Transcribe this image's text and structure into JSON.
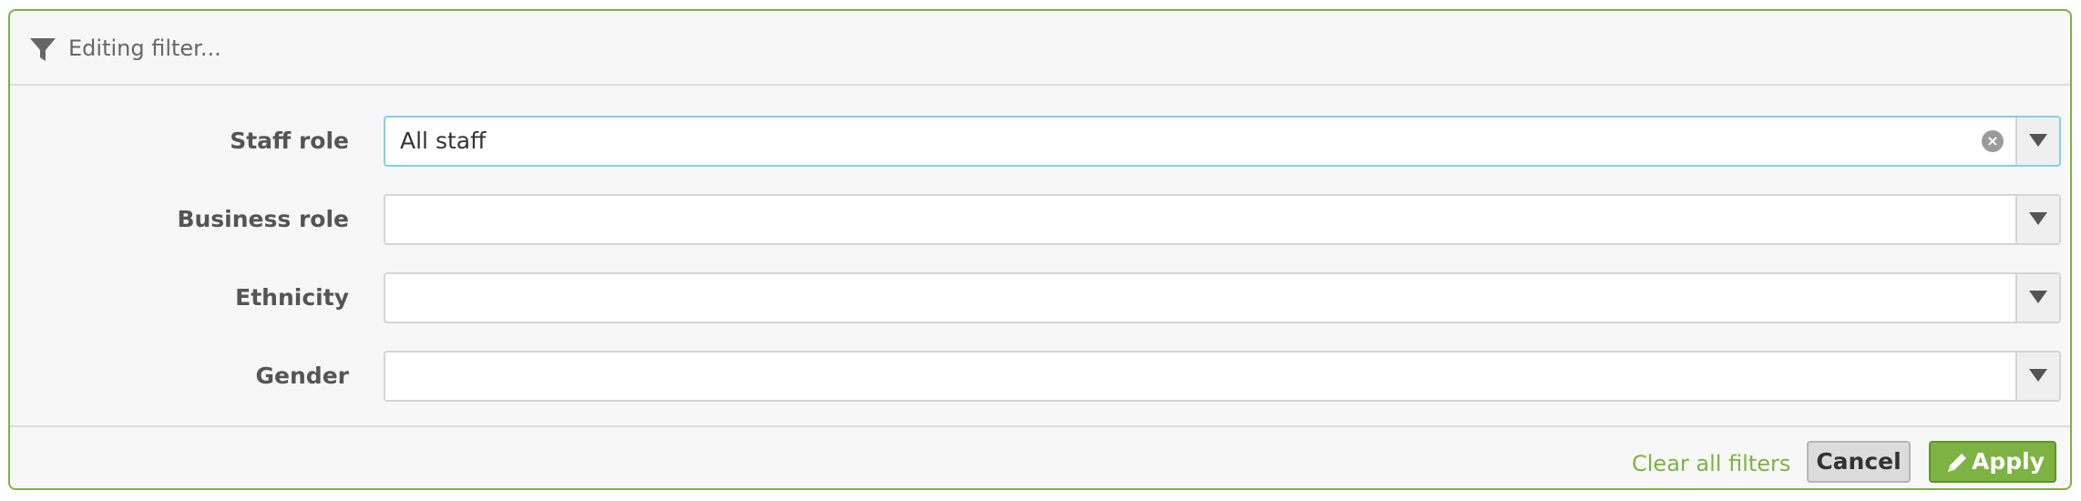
{
  "header": {
    "title": "Editing filter...",
    "icon": "filter-icon"
  },
  "fields": [
    {
      "label": "Staff role",
      "value": "All staff",
      "active": true
    },
    {
      "label": "Business role",
      "value": ""
    },
    {
      "label": "Ethnicity",
      "value": ""
    },
    {
      "label": "Gender",
      "value": ""
    }
  ],
  "footer": {
    "clear_label": "Clear all filters",
    "cancel_label": "Cancel",
    "apply_label": "Apply"
  },
  "colors": {
    "accent": "#7cb342",
    "focus_border": "#7fd2e6"
  }
}
